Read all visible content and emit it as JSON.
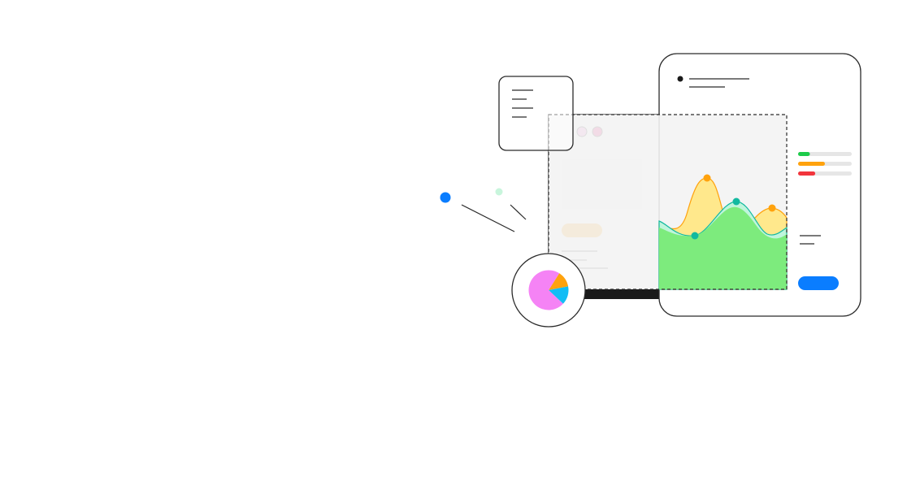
{
  "illustration": {
    "window_controls": [
      {
        "name": "pink-dot",
        "color": "#F281D6"
      },
      {
        "name": "magenta-dot",
        "color": "#E6006E"
      }
    ],
    "progress_bars": [
      {
        "name": "green-progress",
        "color": "#1DCB4A",
        "value": 0.22
      },
      {
        "name": "orange-progress",
        "color": "#FFA20D",
        "value": 0.5
      },
      {
        "name": "red-progress",
        "color": "#F2353C",
        "value": 0.32
      }
    ],
    "pie": {
      "slices": [
        {
          "name": "pink-slice",
          "color": "#F583F5",
          "value": 0.72
        },
        {
          "name": "orange-slice",
          "color": "#FFA20D",
          "value": 0.13
        },
        {
          "name": "cyan-slice",
          "color": "#12BDF5",
          "value": 0.15
        }
      ]
    },
    "floating_dots": [
      {
        "name": "blue-dot",
        "color": "#0A7DFF"
      },
      {
        "name": "mint-dot",
        "color": "#C8F5DC"
      }
    ],
    "colors": {
      "blue_button": "#0A7DFF",
      "orange_button": "#FFA20D",
      "area_green": "#7DEB7D",
      "area_teal": "#BFF5DC",
      "area_yellow": "#FFE88C",
      "line_orange": "#FFA20D",
      "line_teal": "#12B9A0",
      "frame_stroke": "#2B2B2B",
      "bar_dark": "#1A1A1A",
      "panel_gray": "#F3F3F3"
    }
  }
}
